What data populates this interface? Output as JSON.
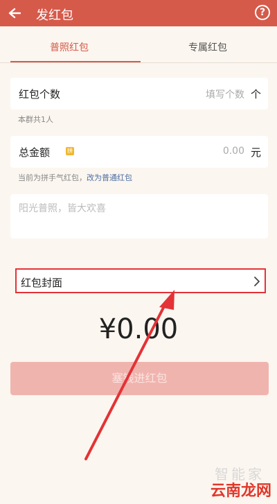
{
  "header": {
    "title": "发红包",
    "help_symbol": "?"
  },
  "tabs": [
    {
      "label": "普照红包",
      "active": true
    },
    {
      "label": "专属红包",
      "active": false
    }
  ],
  "count_row": {
    "label": "红包个数",
    "placeholder": "填写个数",
    "unit": "个"
  },
  "count_hint": "本群共1人",
  "amount_row": {
    "label": "总金额",
    "badge": "拼",
    "value": "0.00",
    "unit": "元"
  },
  "amount_hint": {
    "prefix": "当前为拼手气红包，",
    "link": "改为普通红包"
  },
  "greeting": {
    "placeholder": "阳光普照，皆大欢喜"
  },
  "cover_row": {
    "label": "红包封面"
  },
  "total_display": "¥0.00",
  "submit_button": "塞钱进红包",
  "watermarks": {
    "line1": "智能家",
    "line2": "云南龙网"
  },
  "colors": {
    "header": "#d65a4a",
    "accent": "#d65a4a",
    "highlight_box": "#e43236",
    "button_disabled": "#f0b4ae",
    "link": "#4e6fa3"
  }
}
